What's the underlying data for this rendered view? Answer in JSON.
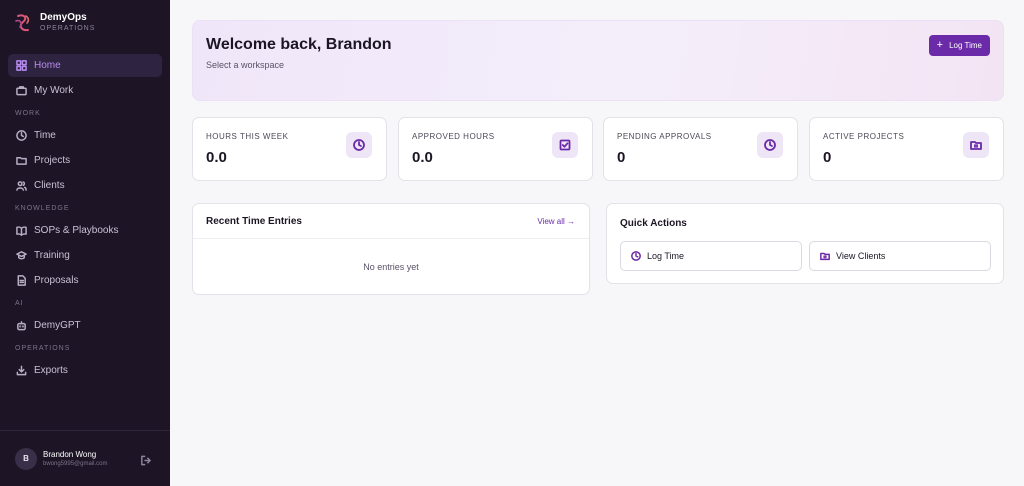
{
  "brand": {
    "name": "DemyOps",
    "subtitle": "OPERATIONS"
  },
  "nav": {
    "home": "Home",
    "my_work": "My Work",
    "work_label": "WORK",
    "time": "Time",
    "projects": "Projects",
    "clients": "Clients",
    "knowledge_label": "KNOWLEDGE",
    "sops": "SOPs & Playbooks",
    "training": "Training",
    "proposals": "Proposals",
    "ai_label": "AI",
    "demygpt": "DemyGPT",
    "operations_label": "OPERATIONS",
    "exports": "Exports"
  },
  "user": {
    "initial": "B",
    "name": "Brandon Wong",
    "email": "bwong5995@gmail.com"
  },
  "hero": {
    "title": "Welcome back, Brandon",
    "subtitle": "Select a workspace",
    "button": "Log Time"
  },
  "stats": [
    {
      "label": "HOURS THIS WEEK",
      "value": "0.0",
      "icon": "clock-icon"
    },
    {
      "label": "APPROVED HOURS",
      "value": "0.0",
      "icon": "check-square-icon"
    },
    {
      "label": "PENDING APPROVALS",
      "value": "0",
      "icon": "clock-icon"
    },
    {
      "label": "ACTIVE PROJECTS",
      "value": "0",
      "icon": "folder-icon"
    }
  ],
  "recent": {
    "title": "Recent Time Entries",
    "view_all": "View all →",
    "empty": "No entries yet"
  },
  "quick_actions": {
    "title": "Quick Actions",
    "log_time": "Log Time",
    "view_clients": "View Clients"
  },
  "colors": {
    "accent": "#6b2aa8",
    "sidebar": "#1d1526",
    "active_nav": "#b98cf0"
  }
}
